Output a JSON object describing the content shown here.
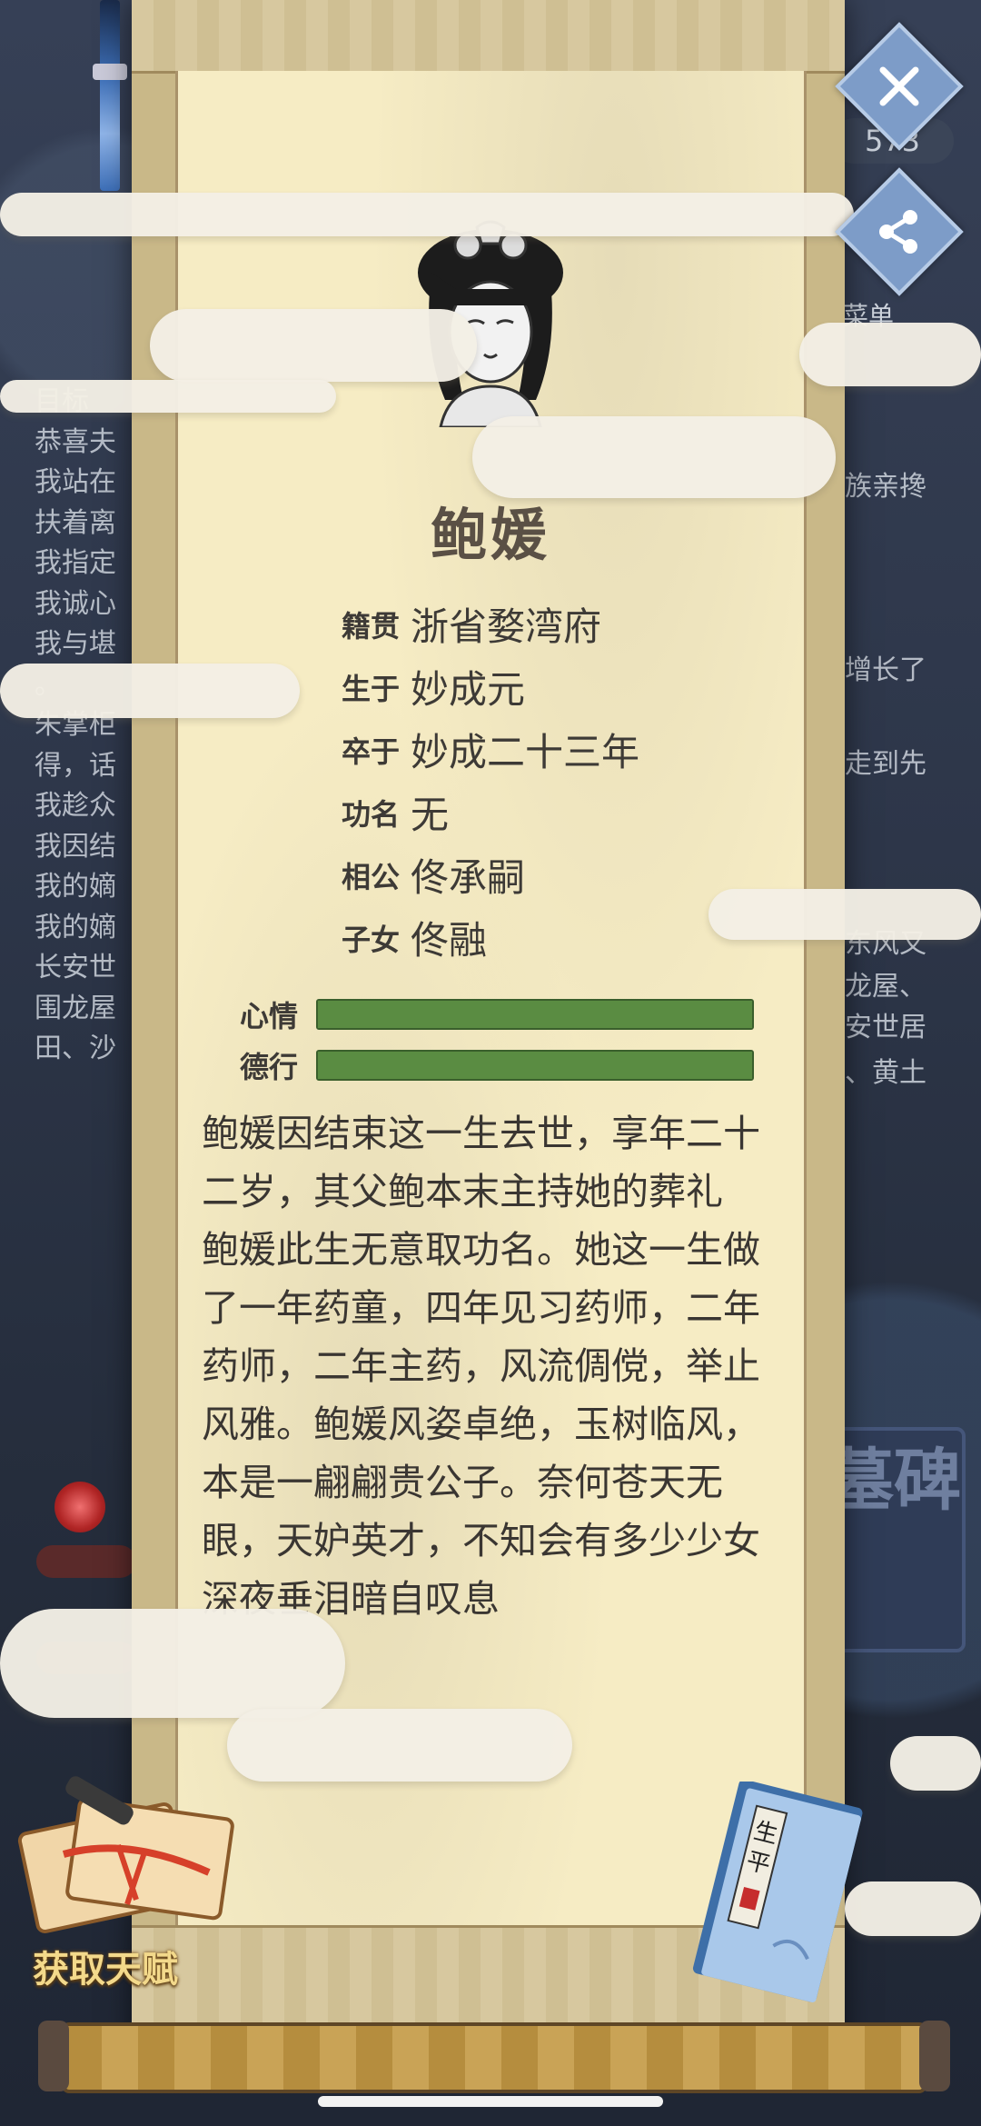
{
  "background": {
    "coins": "573",
    "menu_label": "菜单",
    "tomb_label": "墓碑",
    "text_lines": [
      "目标",
      "恭喜夫",
      "我站在",
      "扶着离",
      "我指定",
      "我诚心",
      "我与堪",
      "。",
      "朱掌柜",
      "得，话",
      "我趁众",
      "我因结",
      "我的嫡",
      "我的嫡",
      "长安世",
      "围龙屋",
      "田、沙"
    ],
    "right_fragments": [
      "族亲搀",
      "增长了",
      "走到先",
      "东风又",
      "龙屋、",
      "长安世居",
      "、黄土"
    ]
  },
  "character": {
    "name": "鲍媛",
    "info": [
      {
        "label": "籍贯",
        "value": "浙省婺湾府"
      },
      {
        "label": "生于",
        "value": "妙成元"
      },
      {
        "label": "卒于",
        "value": "妙成二十三年"
      },
      {
        "label": "功名",
        "value": "无"
      },
      {
        "label": "相公",
        "value": "佟承嗣"
      },
      {
        "label": "子女",
        "value": "佟融"
      }
    ],
    "bars": [
      {
        "label": "心情",
        "level": 1.0
      },
      {
        "label": "德行",
        "level": 1.0
      }
    ],
    "story": [
      "鲍媛因结束这一生去世，享年二十二岁，其父鲍本末主持她的葬礼",
      "鲍媛此生无意取功名。她这一生做了一年药童，四年见习药师，二年药师，二年主药，风流倜傥，举止风雅。鲍媛风姿卓绝，玉树临风，本是一翩翩贵公子。奈何苍天无眼，天妒英才，不知会有多少少女深夜垂泪暗自叹息"
    ]
  },
  "controls": {
    "close_icon": "close-icon",
    "share_icon": "share-icon",
    "talent_label": "获取天赋",
    "book_title": "生平"
  },
  "colors": {
    "paper": "#f6ecc4",
    "bar_green": "#5a8c42",
    "button_blue": "#7d9cc8",
    "gold_text": "#f3d98b"
  }
}
